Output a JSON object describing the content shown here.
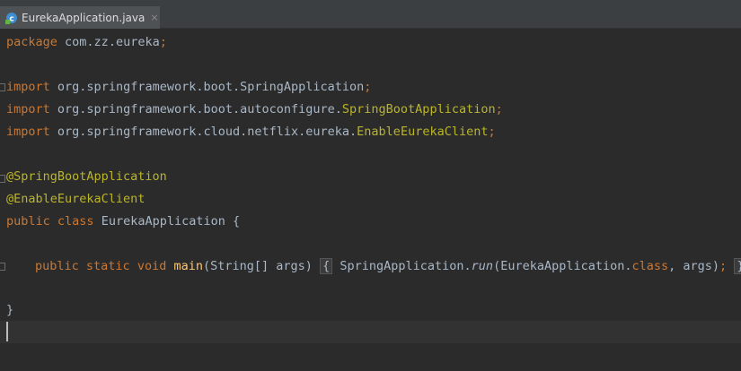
{
  "tab": {
    "label": "EurekaApplication.java",
    "close_glyph": "×",
    "icon": "java-class-icon"
  },
  "code": {
    "line1": {
      "kw": "package",
      "rest": "com.zz.eureka",
      "semi": ";"
    },
    "line3": {
      "kw": "import",
      "pkg": "org.springframework.boot.",
      "cls": "SpringApplication",
      "semi": ";"
    },
    "line4": {
      "kw": "import",
      "pkg": "org.springframework.boot.autoconfigure.",
      "cls": "SpringBootApplication",
      "semi": ";"
    },
    "line5": {
      "kw": "import",
      "pkg": "org.springframework.cloud.netflix.eureka.",
      "cls": "EnableEurekaClient",
      "semi": ";"
    },
    "line7": {
      "ann": "@SpringBootApplication"
    },
    "line8": {
      "ann": "@EnableEurekaClient"
    },
    "line9": {
      "kw1": "public",
      "kw2": "class",
      "name": "EurekaApplication",
      "brace": "{"
    },
    "line11": {
      "kw1": "public",
      "kw2": "static",
      "kw3": "void",
      "method": "main",
      "params": "(String[] args)",
      "open": "{",
      "call_cls": "SpringApplication.",
      "call_fn": "run",
      "arg_cls": "(EurekaApplication.",
      "arg_kw": "class",
      "arg_rest": ", args)",
      "semi": ";",
      "close": "}"
    },
    "line13": {
      "brace": "}"
    }
  },
  "colors": {
    "background": "#2b2b2b",
    "keyword": "#cc7832",
    "annotation": "#bbb529",
    "plain": "#a9b7c6",
    "method": "#ffc66d",
    "current_line": "#323232"
  }
}
